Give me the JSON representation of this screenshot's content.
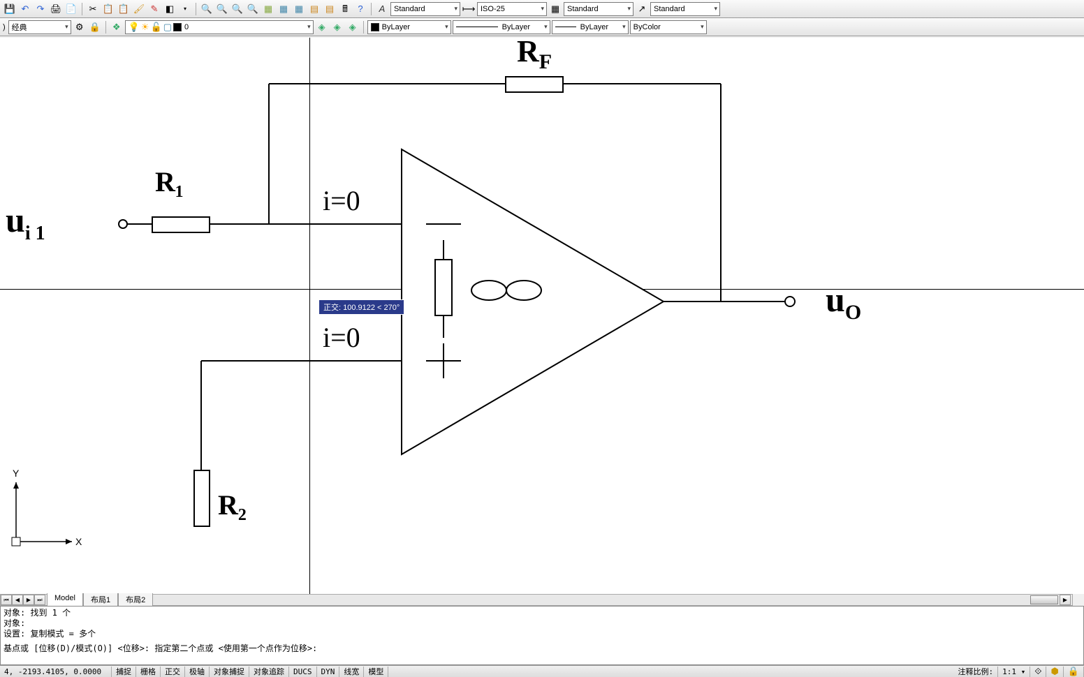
{
  "toolbar1": {
    "styles": {
      "text_style": "Standard",
      "dim_style": "ISO-25",
      "table_style": "Standard",
      "mleader_style": "Standard"
    }
  },
  "toolbar2": {
    "workspace": "经典",
    "layer": "0",
    "linetype": "ByLayer",
    "lineweight": "ByLayer",
    "color_label": "ByLayer",
    "plot_style": "ByColor"
  },
  "canvas": {
    "tooltip": "正交: 100.9122 < 270°",
    "labels": {
      "r1": "R₁",
      "rf": "R",
      "rf_sub": "F",
      "r2": "R₂",
      "ui1": "u",
      "ui1_sub": "i 1",
      "uo": "u",
      "uo_sub": "O",
      "i0a": "i=0",
      "i0b": "i=0",
      "inf": "∞"
    },
    "ucs": {
      "x": "X",
      "y": "Y"
    }
  },
  "tabs": {
    "model": "Model",
    "layout1": "布局1",
    "layout2": "布局2"
  },
  "command": {
    "line1": "对象: 找到 1 个",
    "line2": "对象:",
    "line3": "设置:  复制模式 = 多个",
    "line4": "基点或 [位移(D)/模式(O)] <位移>: 指定第二个点或 <使用第一个点作为位移>:"
  },
  "status": {
    "coords": "4, -2193.4105, 0.0000",
    "snap": "捕捉",
    "grid": "栅格",
    "ortho": "正交",
    "polar": "极轴",
    "osnap": "对象捕捉",
    "otrack": "对象追踪",
    "ducs": "DUCS",
    "dyn": "DYN",
    "lwt": "线宽",
    "model": "模型",
    "anno_label": "注释比例:",
    "anno_scale": "1:1"
  }
}
